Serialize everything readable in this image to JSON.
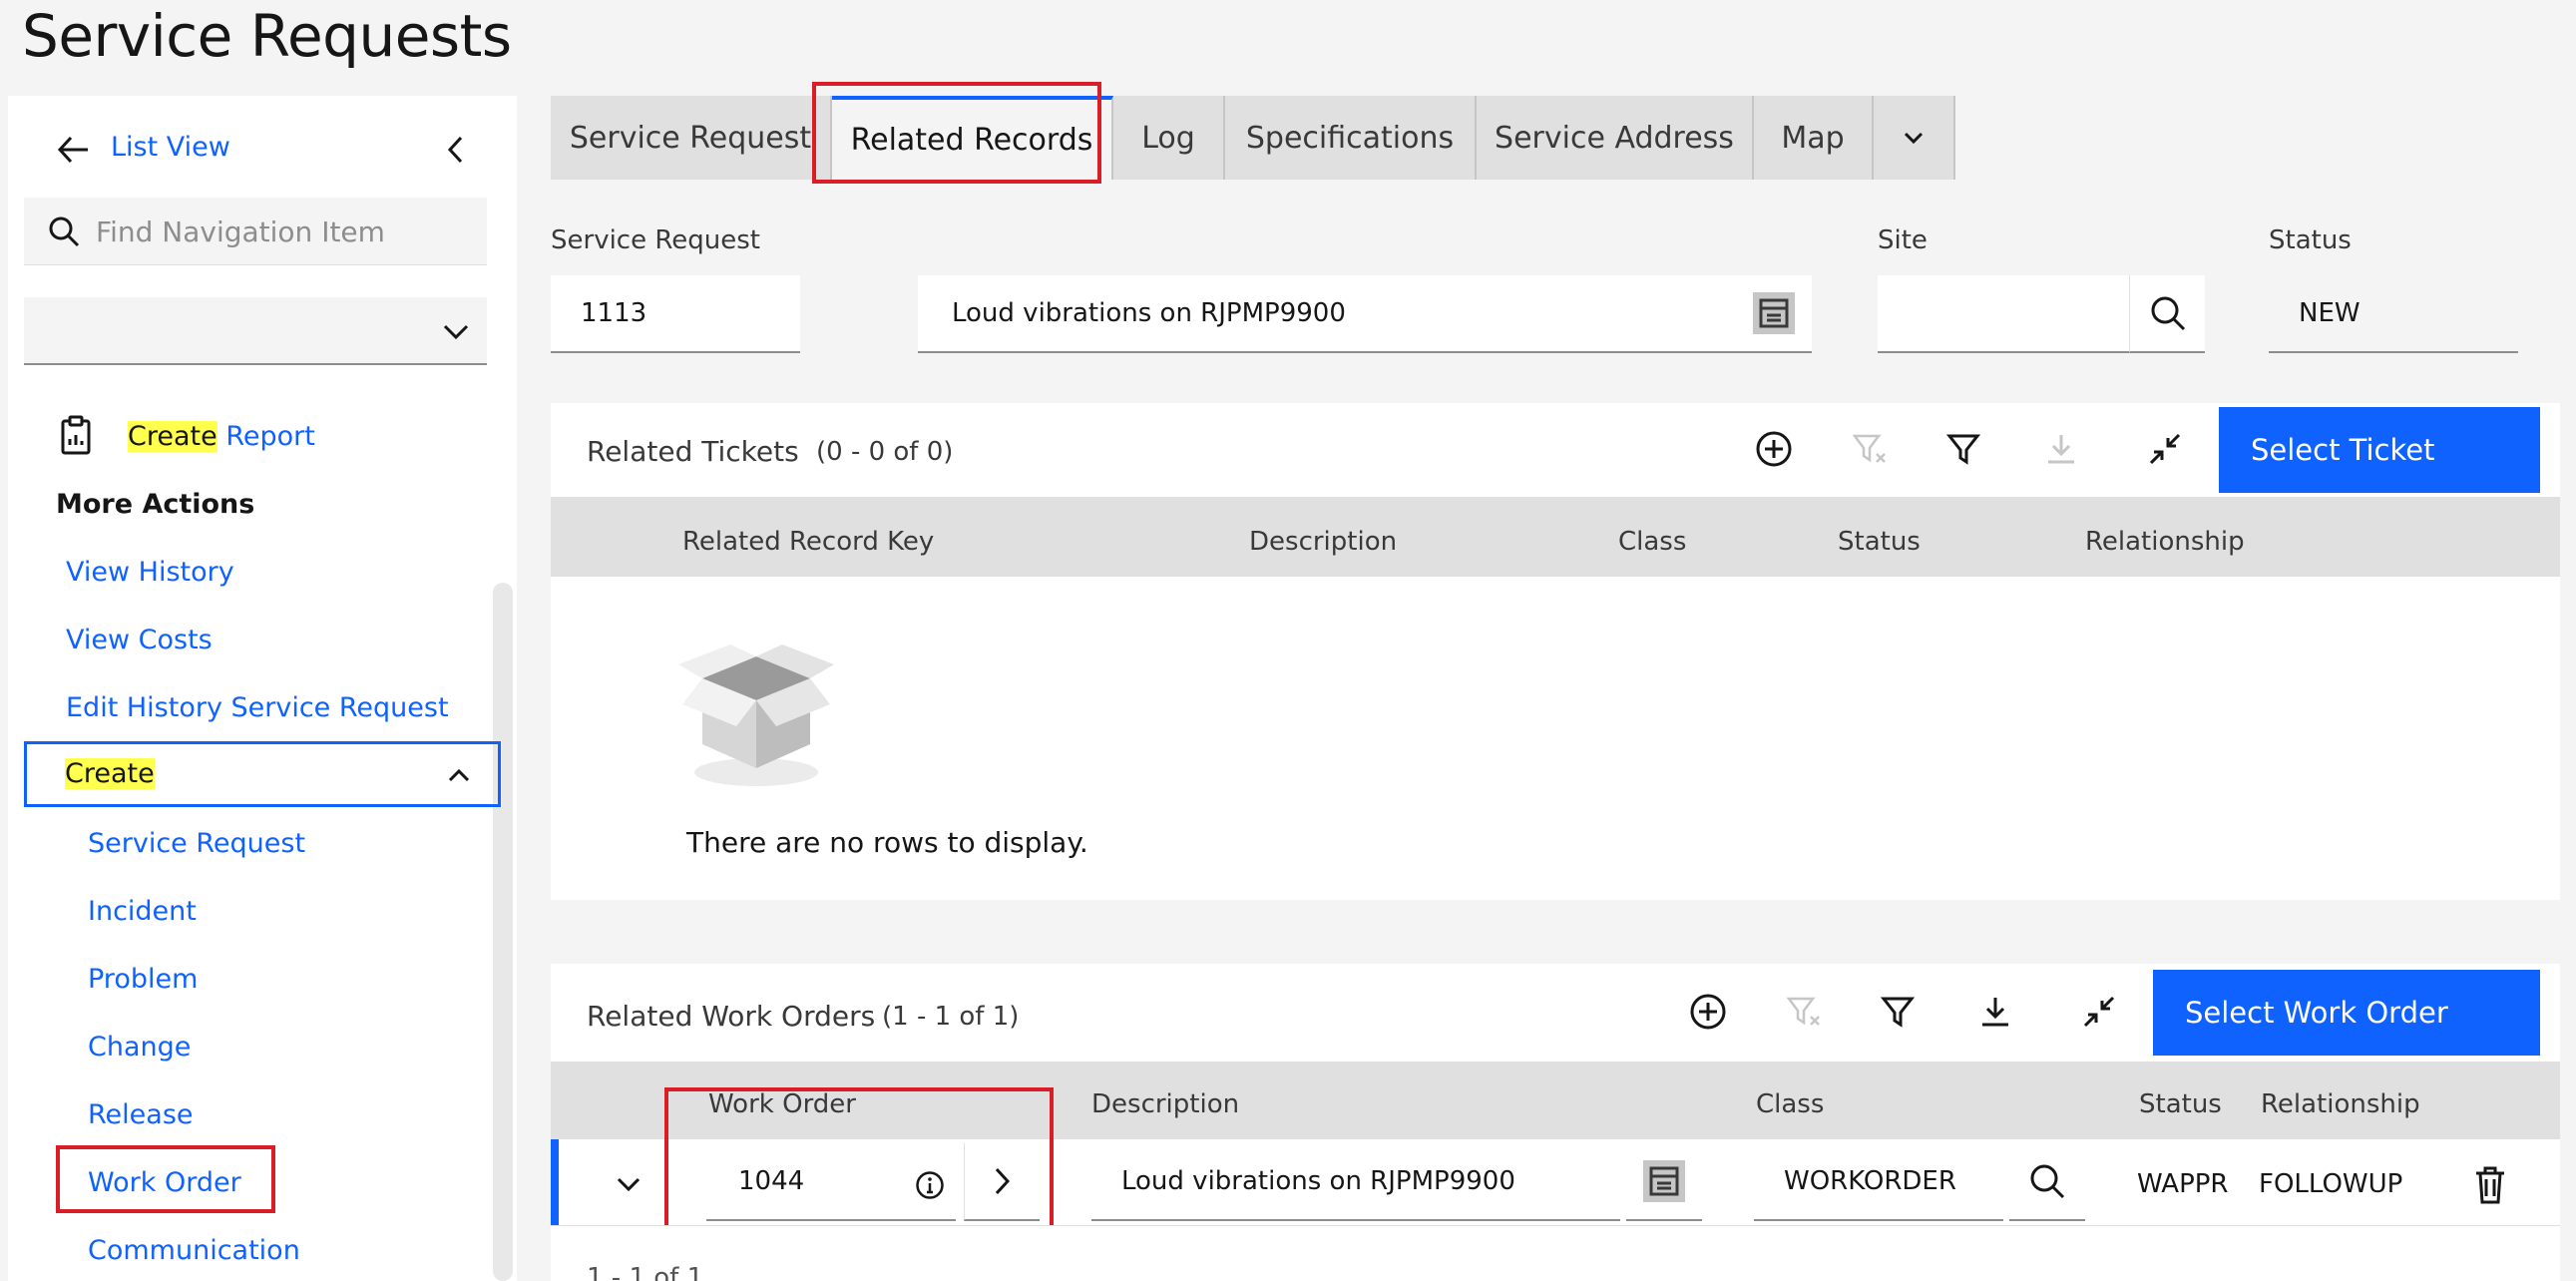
{
  "page": {
    "title": "Service Requests"
  },
  "sidebar": {
    "list_view": "List View",
    "search_placeholder": "Find Navigation Item",
    "create_report_prefix": "Create",
    "create_report_suffix": "Report",
    "more_actions": "More Actions",
    "actions": [
      "View History",
      "View Costs",
      "Edit History Service Request"
    ],
    "create_label": "Create",
    "create_items": [
      "Service Request",
      "Incident",
      "Problem",
      "Change",
      "Release",
      "Work Order",
      "Communication"
    ]
  },
  "tabs": [
    "Service Request",
    "Related Records",
    "Log",
    "Specifications",
    "Service Address",
    "Map"
  ],
  "form": {
    "sr_label": "Service Request",
    "sr_value": "1113",
    "sr_desc": "Loud vibrations on RJPMP9900",
    "site_label": "Site",
    "site_value": "",
    "status_label": "Status",
    "status_value": "NEW"
  },
  "related_tickets": {
    "title": "Related Tickets",
    "count": "(0 - 0 of 0)",
    "select_button": "Select Ticket",
    "columns": [
      "Related Record Key",
      "Description",
      "Class",
      "Status",
      "Relationship"
    ],
    "empty_text": "There are no rows to display."
  },
  "related_work_orders": {
    "title": "Related Work Orders",
    "count": "(1 - 1 of 1)",
    "select_button": "Select Work Order",
    "columns": [
      "Work Order",
      "Description",
      "Class",
      "Status",
      "Relationship"
    ],
    "rows": [
      {
        "work_order": "1044",
        "description": "Loud vibrations on RJPMP9900",
        "class": "WORKORDER",
        "status": "WAPPR",
        "relationship": "FOLLOWUP"
      }
    ],
    "pagination": "1 - 1 of 1"
  },
  "colors": {
    "accent": "#0f62fe",
    "highlight": "#ffff4d",
    "annotation": "#da1e28"
  }
}
